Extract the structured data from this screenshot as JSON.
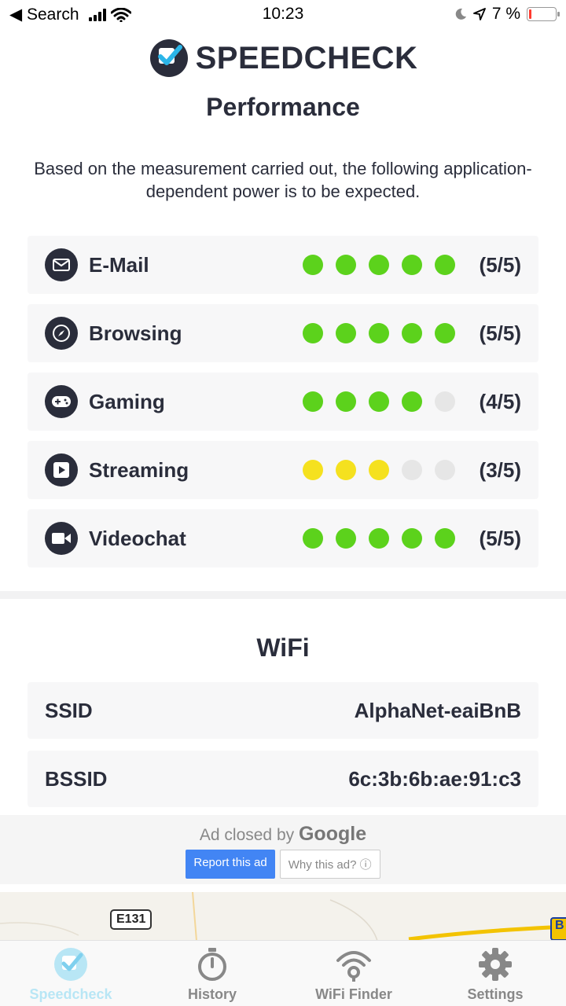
{
  "status_bar": {
    "back_label": "◀ Search",
    "time": "10:23",
    "battery": "7 %"
  },
  "brand": {
    "name": "SPEEDCHECK"
  },
  "page_title": "Performance",
  "intro": "Based on the measurement carried out, the following application-dependent power is to be expected.",
  "colors": {
    "green": "#5cd21c",
    "yellow": "#f5e11f",
    "empty": "#e6e6e6",
    "icon_bg": "#2a2d3b"
  },
  "performance": [
    {
      "label": "E-Mail",
      "icon": "mail-icon",
      "rating": 5,
      "max": 5,
      "color": "green",
      "score_text": "(5/5)"
    },
    {
      "label": "Browsing",
      "icon": "compass-icon",
      "rating": 5,
      "max": 5,
      "color": "green",
      "score_text": "(5/5)"
    },
    {
      "label": "Gaming",
      "icon": "gamepad-icon",
      "rating": 4,
      "max": 5,
      "color": "green",
      "score_text": "(4/5)"
    },
    {
      "label": "Streaming",
      "icon": "play-icon",
      "rating": 3,
      "max": 5,
      "color": "yellow",
      "score_text": "(3/5)"
    },
    {
      "label": "Videochat",
      "icon": "video-camera-icon",
      "rating": 5,
      "max": 5,
      "color": "green",
      "score_text": "(5/5)"
    }
  ],
  "wifi": {
    "title": "WiFi",
    "rows": [
      {
        "key": "SSID",
        "value": "AlphaNet-eaiBnB"
      },
      {
        "key": "BSSID",
        "value": "6c:3b:6b:ae:91:c3"
      }
    ]
  },
  "ad": {
    "closed_prefix": "Ad closed by",
    "closed_brand": "Google",
    "report_label": "Report this ad",
    "why_label": "Why this ad? ⓘ"
  },
  "map": {
    "road_sign": "E131",
    "corner_sign": "B"
  },
  "tabs": [
    {
      "label": "Speedcheck",
      "icon": "speedcheck-icon",
      "active": true
    },
    {
      "label": "History",
      "icon": "stopwatch-icon",
      "active": false
    },
    {
      "label": "WiFi Finder",
      "icon": "wifi-finder-icon",
      "active": false
    },
    {
      "label": "Settings",
      "icon": "gear-icon",
      "active": false
    }
  ]
}
